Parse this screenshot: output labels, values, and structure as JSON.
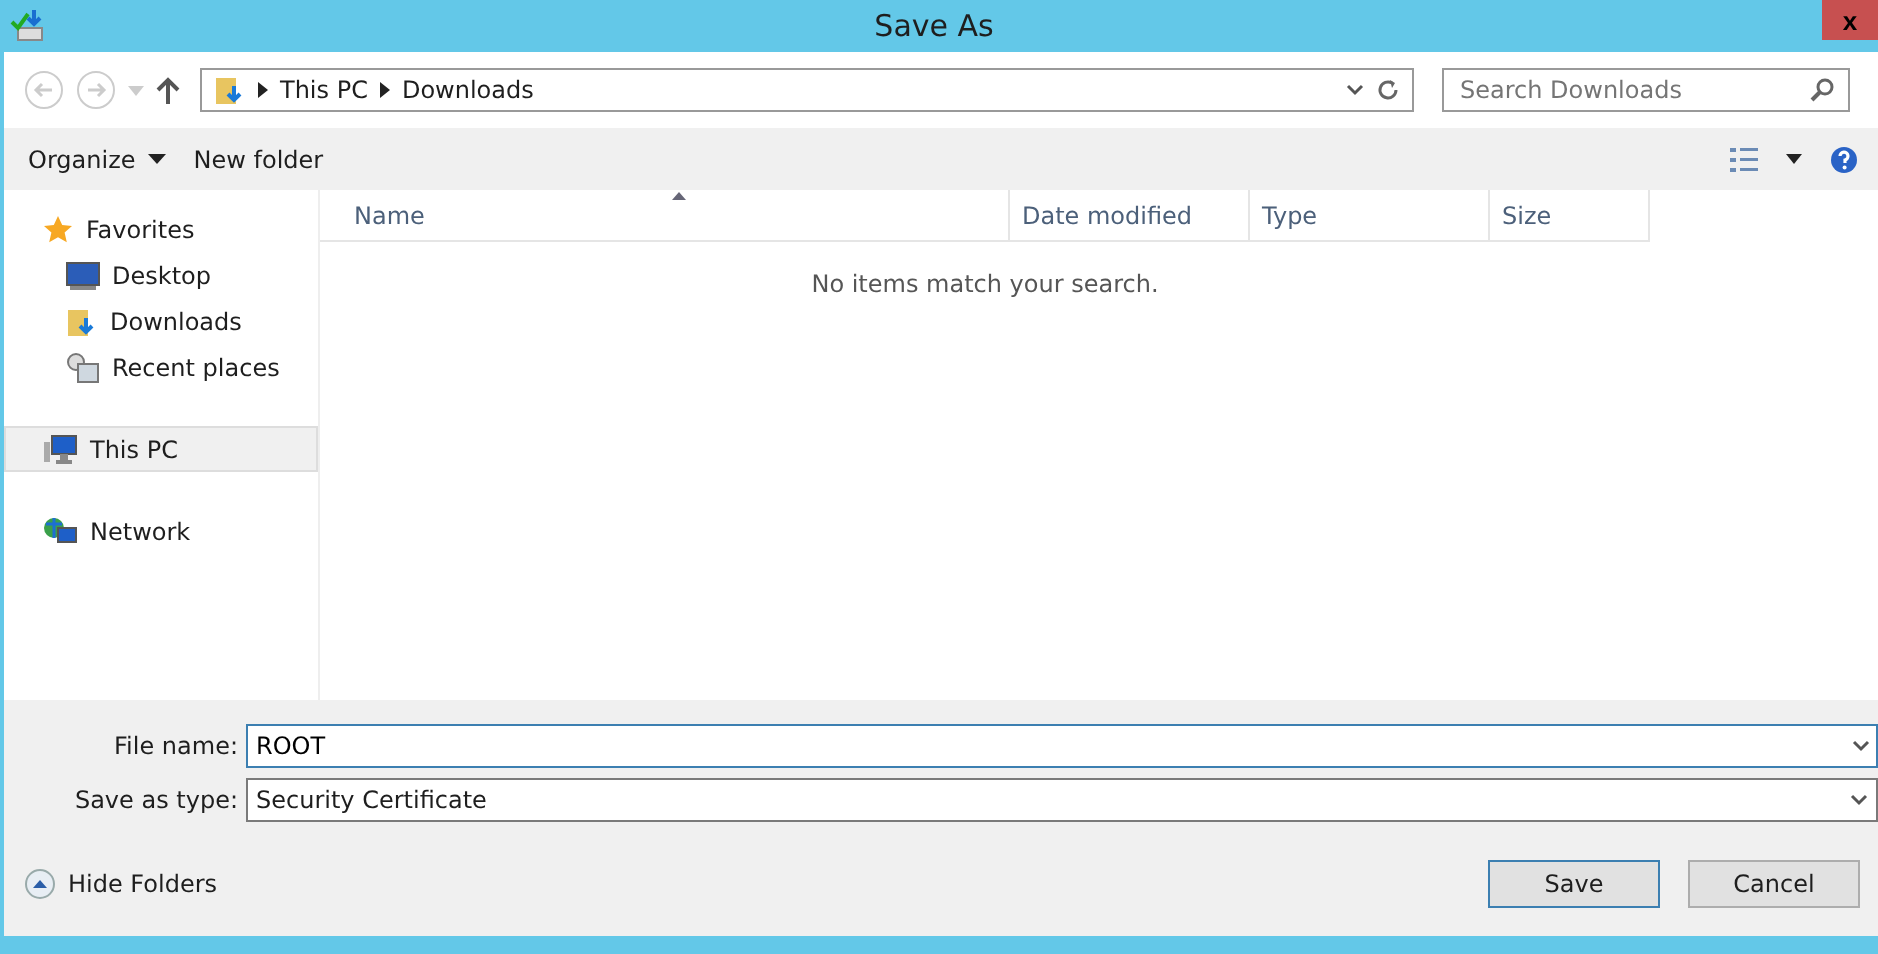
{
  "window": {
    "title": "Save As",
    "close": "x"
  },
  "address": {
    "crumbs": [
      "This PC",
      "Downloads"
    ]
  },
  "search": {
    "placeholder": "Search Downloads"
  },
  "toolbar": {
    "organize": "Organize",
    "new_folder": "New folder"
  },
  "sidebar": {
    "items": [
      {
        "label": "Favorites",
        "selected": false,
        "children": [
          {
            "label": "Desktop",
            "selected": false
          },
          {
            "label": "Downloads",
            "selected": false
          },
          {
            "label": "Recent places",
            "selected": false
          }
        ]
      },
      {
        "label": "This PC",
        "selected": true
      },
      {
        "label": "Network",
        "selected": false
      }
    ]
  },
  "table": {
    "columns": [
      "Name",
      "Date modified",
      "Type",
      "Size"
    ],
    "empty_message": "No items match your search."
  },
  "form": {
    "file_name_label": "File name:",
    "file_name": "ROOT",
    "type_label": "Save as type:",
    "type": "Security Certificate"
  },
  "hide_folders": "Hide Folders",
  "buttons": [
    "Save",
    "Cancel"
  ]
}
